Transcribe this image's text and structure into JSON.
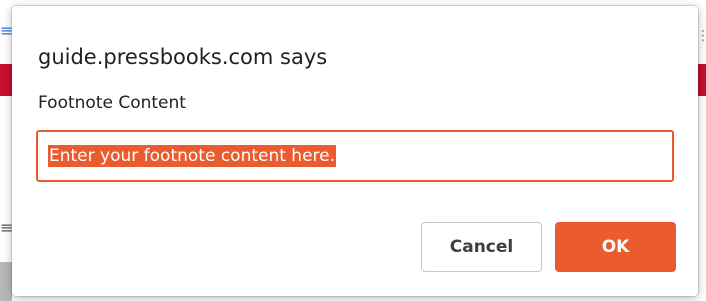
{
  "background": {
    "top_icon": "≡",
    "right_icon": "⋮",
    "mid_icon": "≡"
  },
  "dialog": {
    "title": "guide.pressbooks.com says",
    "field_label": "Footnote Content",
    "input_value": "Enter your footnote content here.",
    "cancel_label": "Cancel",
    "ok_label": "OK"
  },
  "colors": {
    "accent": "#ea5b2e",
    "brand_red": "#c8102e"
  }
}
